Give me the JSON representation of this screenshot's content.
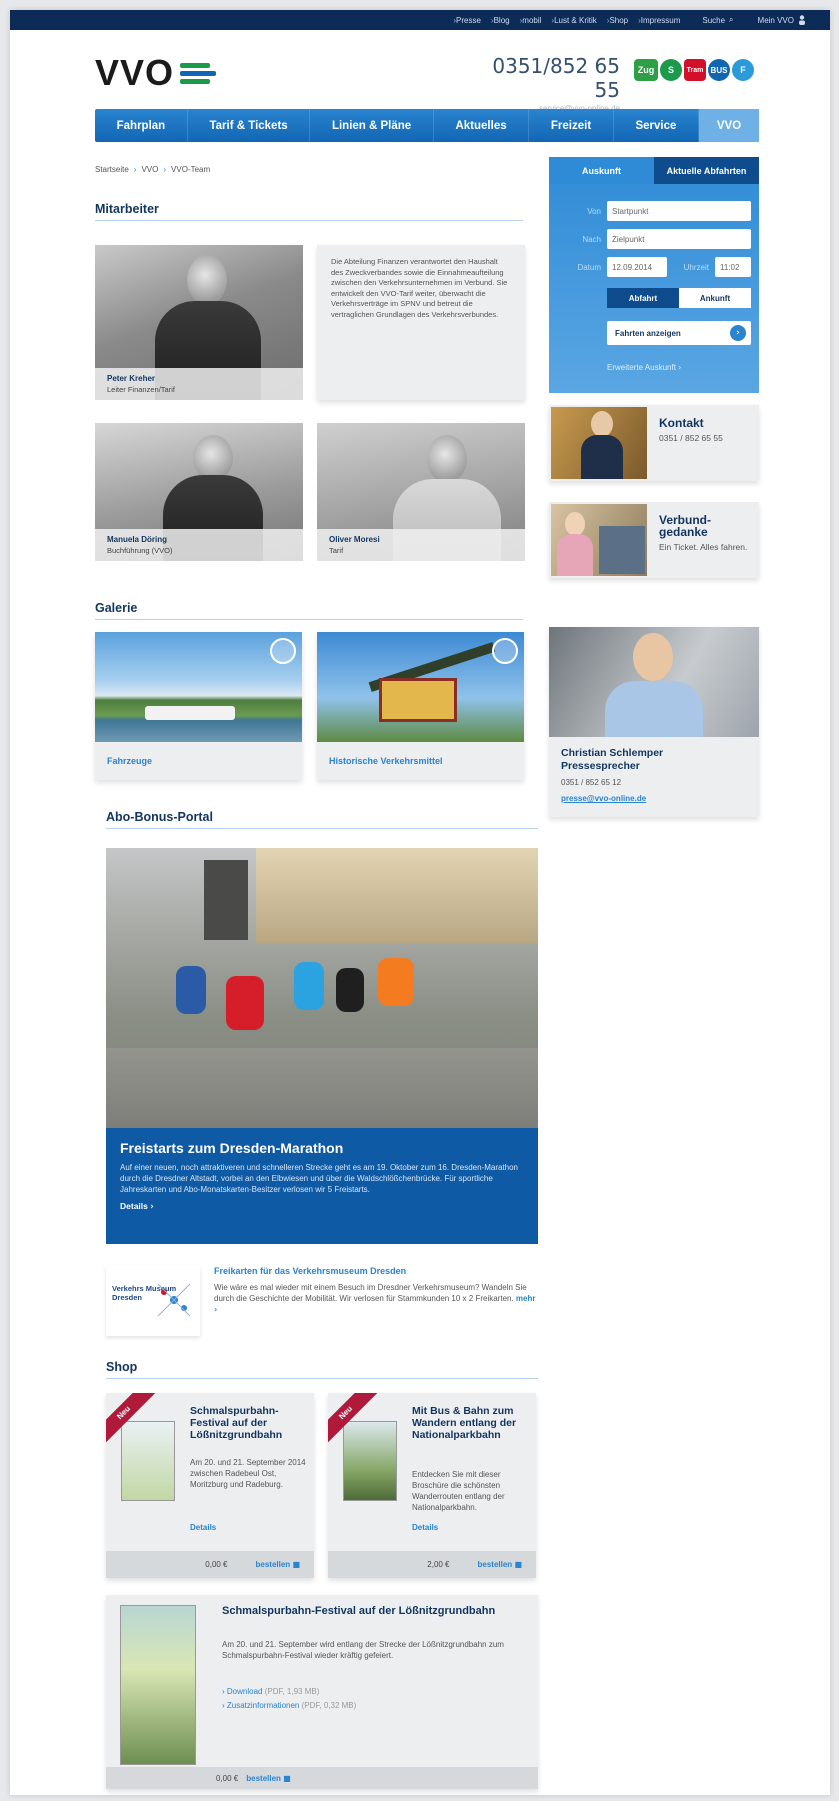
{
  "topbar": {
    "links": [
      "Presse",
      "Blog",
      "mobil",
      "Lust & Kritik",
      "Shop",
      "Impressum"
    ],
    "search_label": "Suche",
    "my_vvo_label": "Mein VVO"
  },
  "header": {
    "logo_text": "VVO",
    "phone": "0351/852 65 55",
    "email": "service@vvo-online.de",
    "modes": [
      "Zug",
      "S",
      "Tram",
      "BUS",
      "F"
    ]
  },
  "nav": {
    "items": [
      "Fahrplan",
      "Tarif & Tickets",
      "Linien & Pläne",
      "Aktuelles",
      "Freizeit",
      "Service",
      "VVO"
    ]
  },
  "breadcrumb": [
    "Startseite",
    "VVO",
    "VVO-Team"
  ],
  "staff": {
    "title": "Mitarbeiter",
    "people": [
      {
        "name": "Peter Kreher",
        "role": "Leiter Finanzen/Tarif"
      },
      {
        "name": "Manuela Döring",
        "role": "Buchführung (VVO)"
      },
      {
        "name": "Oliver Moresi",
        "role": "Tarif"
      }
    ],
    "description": "Die Abteilung Finanzen verantwortet den Haushalt des Zweckverbandes sowie die Einnahmeaufteilung zwischen den Verkehrsunternehmen im Verbund. Sie entwickelt den VVO-Tarif weiter, überwacht die Verkehrsverträge im SPNV und betreut die vertraglichen Grundlagen des Verkehrsverbundes."
  },
  "planner": {
    "tab_active": "Auskunft",
    "tab_other": "Aktuelle Abfahrten",
    "from_label": "Von",
    "from_placeholder": "Startpunkt",
    "to_label": "Nach",
    "to_placeholder": "Zielpunkt",
    "date_label": "Datum",
    "date_value": "12.09.2014",
    "time_label": "Uhrzeit",
    "time_value": "11:02",
    "depart_label": "Abfahrt",
    "arrive_label": "Ankunft",
    "search_label": "Fahrten anzeigen",
    "advanced_label": "Erweiterte Auskunft"
  },
  "side_cards": [
    {
      "title": "Kontakt",
      "desc": "0351 / 852 65 55"
    },
    {
      "title": "Verbund-gedanke",
      "desc": "Ein Ticket. Alles fahren."
    }
  ],
  "gallery": {
    "title": "Galerie",
    "items": [
      "Fahrzeuge",
      "Historische Verkehrsmittel"
    ]
  },
  "press": {
    "name": "Christian Schlemper",
    "role": "Pressesprecher",
    "phone": "0351 / 852 65 12",
    "email": "presse@vvo-online.de"
  },
  "abo": {
    "title": "Abo-Bonus-Portal",
    "headline": "Freistarts zum Dresden-Marathon",
    "text": "Auf einer neuen, noch attraktiveren und schnelleren Strecke geht es am 19. Oktober zum 16. Dresden-Marathon durch die Dresdner Altstadt, vorbei an den Elbwiesen und über die Waldschlößchenbrücke. Für sportliche Jahreskarten und Abo-Monatskarten-Besitzer verlosen wir 5 Freistarts.",
    "more": "Details"
  },
  "promo": {
    "logo_text": "Verkehrs Museum Dresden",
    "title": "Freikarten für das Verkehrsmuseum Dresden",
    "text": "Wie wäre es mal wieder mit einem Besuch im Dresdner Verkehrsmuseum? Wandeln Sie durch die Geschichte der Mobilität. Wir verlosen für Stammkunden 10 x 2 Freikarten.",
    "more": "mehr"
  },
  "shop": {
    "title": "Shop",
    "badge": "Neu",
    "products": [
      {
        "title": "Schmalspurbahn-Festival auf der Lößnitzgrundbahn",
        "desc": "Am 20. und 21. September 2014 zwischen Radebeul Ost, Moritzburg und Radeburg.",
        "link": "Details",
        "price": "0,00 €",
        "order": "bestellen"
      },
      {
        "title": "Mit Bus & Bahn zum Wandern entlang der Nationalparkbahn",
        "desc": "Entdecken Sie mit dieser Broschüre die schönsten Wanderrouten entlang der Nationalparkbahn.",
        "link": "Details",
        "price": "2,00 €",
        "order": "bestellen"
      }
    ],
    "feature": {
      "title": "Schmalspurbahn-Festival auf der Lößnitzgrundbahn",
      "desc": "Am 20. und 21. September wird entlang der Strecke der Lößnitzgrundbahn zum Schmalspurbahn-Festival wieder kräftig gefeiert.",
      "download": "Download",
      "download_meta": "(PDF, 1,93 MB)",
      "extra": "Zusatzinformationen",
      "extra_meta": "(PDF, 0,32 MB)",
      "price": "0,00 €",
      "order": "bestellen"
    }
  },
  "colors": {
    "brand_blue": "#1166b3",
    "dark_navy": "#0d2b57",
    "new_red": "#b01a3a"
  }
}
